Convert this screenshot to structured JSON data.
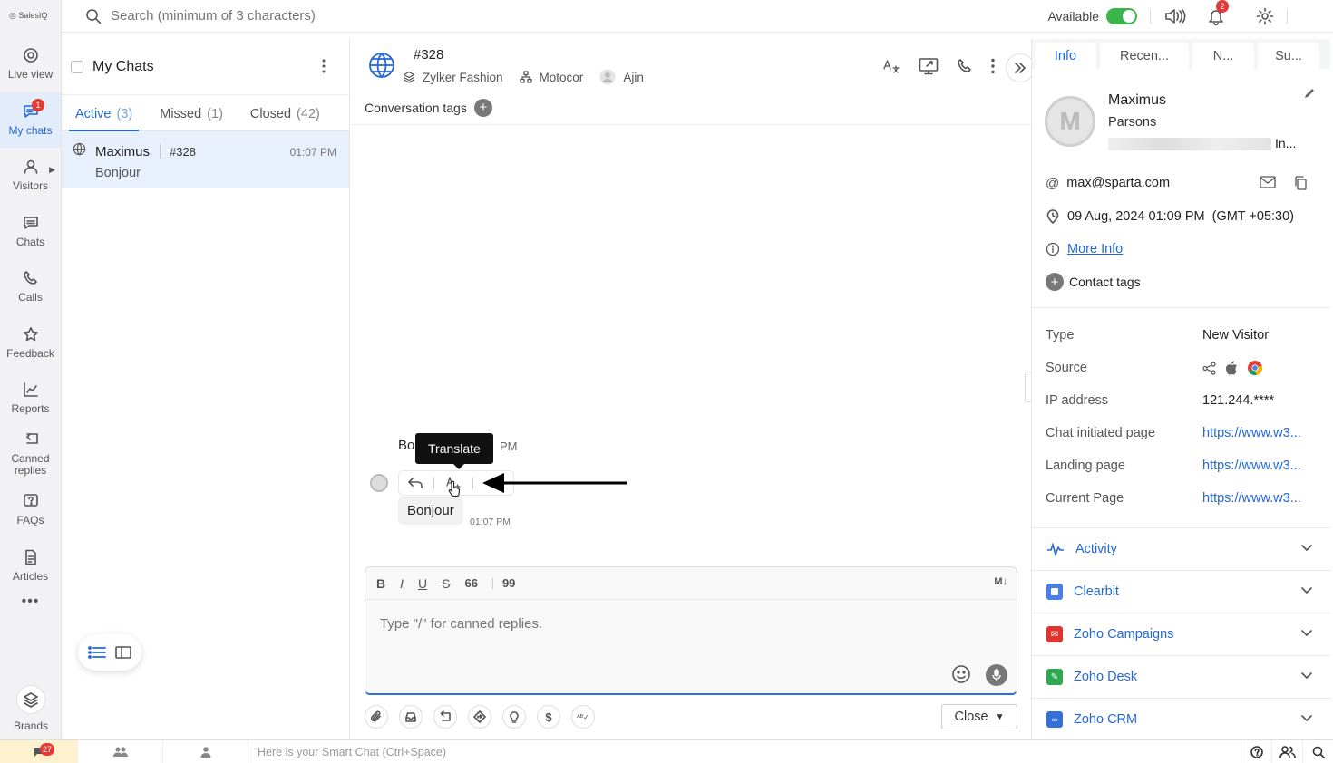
{
  "brand": "SalesIQ",
  "search": {
    "placeholder": "Search (minimum of 3 characters)"
  },
  "topbar": {
    "status_label": "Available",
    "notifications_count": "2"
  },
  "nav": {
    "items": [
      {
        "label": "Live view"
      },
      {
        "label": "My chats",
        "badge": "1"
      },
      {
        "label": "Visitors"
      },
      {
        "label": "Chats"
      },
      {
        "label": "Calls"
      },
      {
        "label": "Feedback"
      },
      {
        "label": "Reports"
      },
      {
        "label": "Canned replies"
      },
      {
        "label": "FAQs"
      },
      {
        "label": "Articles"
      }
    ],
    "more": "•••",
    "brands_label": "Brands"
  },
  "chatlist": {
    "title": "My Chats",
    "tabs": [
      {
        "label": "Active",
        "count": "(3)"
      },
      {
        "label": "Missed",
        "count": "(1)"
      },
      {
        "label": "Closed",
        "count": "(42)"
      }
    ],
    "rows": [
      {
        "name": "Maximus",
        "id": "#328",
        "time": "01:07 PM",
        "message": "Bonjour"
      }
    ]
  },
  "conversation": {
    "id": "#328",
    "brand": "Zylker Fashion",
    "department": "Motocor",
    "operator": "Ajin",
    "tags_label": "Conversation tags",
    "tooltip": "Translate",
    "behind_text_start": "Bo",
    "behind_text_end": "PM",
    "message_text": "Bonjour",
    "message_time": "01:07 PM",
    "composer_placeholder": "Type \"/\" for canned replies.",
    "format_buttons": [
      "B",
      "I",
      "U",
      "S",
      "66",
      "99"
    ],
    "markdown_label": "M↓",
    "close_label": "Close"
  },
  "info_panel": {
    "tabs": [
      "Info",
      "Recen...",
      "N...",
      "Su..."
    ],
    "first_name": "Maximus",
    "last_name": "Parsons",
    "company_suffix": "In...",
    "email": "max@sparta.com",
    "datetime": "09 Aug, 2024 01:09 PM  (GMT +05:30)",
    "more_info": "More Info",
    "contact_tags": "Contact tags",
    "details": [
      {
        "key": "Type",
        "value": "New Visitor"
      },
      {
        "key": "Source",
        "value": ""
      },
      {
        "key": "IP address",
        "value": "121.244.****"
      },
      {
        "key": "Chat initiated page",
        "value": "https://www.w3..."
      },
      {
        "key": "Landing page",
        "value": "https://www.w3..."
      },
      {
        "key": "Current Page",
        "value": "https://www.w3..."
      }
    ],
    "sections": [
      "Activity",
      "Clearbit",
      "Zoho Campaigns",
      "Zoho Desk",
      "Zoho CRM"
    ]
  },
  "bottombar": {
    "notify_count": "27",
    "smart_chat_placeholder": "Here is your Smart Chat (Ctrl+Space)"
  },
  "colors": {
    "accent": "#2468d6",
    "active_bg": "#e8f0fc",
    "toggle": "#3bb54a",
    "badge": "#e53935"
  }
}
